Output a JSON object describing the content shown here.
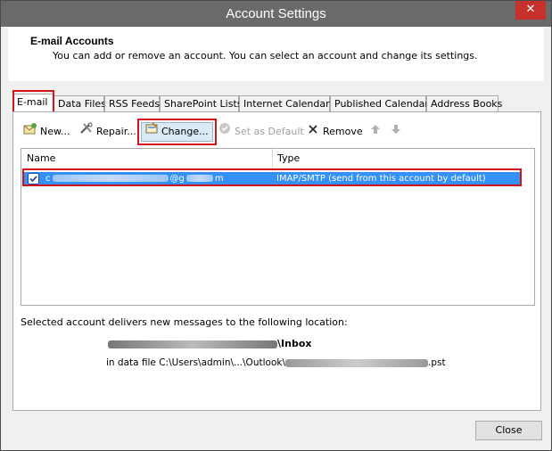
{
  "window": {
    "title": "Account Settings",
    "close_glyph": "✕"
  },
  "header": {
    "title": "E-mail Accounts",
    "description": "You can add or remove an account. You can select an account and change its settings."
  },
  "tabs": [
    {
      "label": "E-mail"
    },
    {
      "label": "Data Files"
    },
    {
      "label": "RSS Feeds"
    },
    {
      "label": "SharePoint Lists"
    },
    {
      "label": "Internet Calendars"
    },
    {
      "label": "Published Calendars"
    },
    {
      "label": "Address Books"
    }
  ],
  "toolbar": {
    "new": "New...",
    "repair": "Repair...",
    "change": "Change...",
    "set_default": "Set as Default",
    "remove": "Remove",
    "icons": {
      "new": "new-account-icon",
      "repair": "repair-tools-icon",
      "change": "change-settings-icon",
      "set_default": "checkmark-icon",
      "remove": "remove-x-icon",
      "up": "arrow-up-icon",
      "down": "arrow-down-icon"
    }
  },
  "accounts": {
    "columns": [
      "Name",
      "Type"
    ],
    "rows": [
      {
        "name_visible_start": "c",
        "name_visible_mid": "@g",
        "name_visible_end": "m",
        "type": "IMAP/SMTP (send from this account by default)"
      }
    ]
  },
  "location": {
    "text": "Selected account delivers new messages to the following location:",
    "inbox_suffix": "\\Inbox",
    "datafile_prefix": "in data file C:\\Users\\admin\\...\\Outlook\\",
    "datafile_suffix": ".pst"
  },
  "footer": {
    "close": "Close"
  },
  "colors": {
    "selection": "#3391f8",
    "highlight_border": "#d3121b",
    "titlebar": "#6a6a6a"
  }
}
